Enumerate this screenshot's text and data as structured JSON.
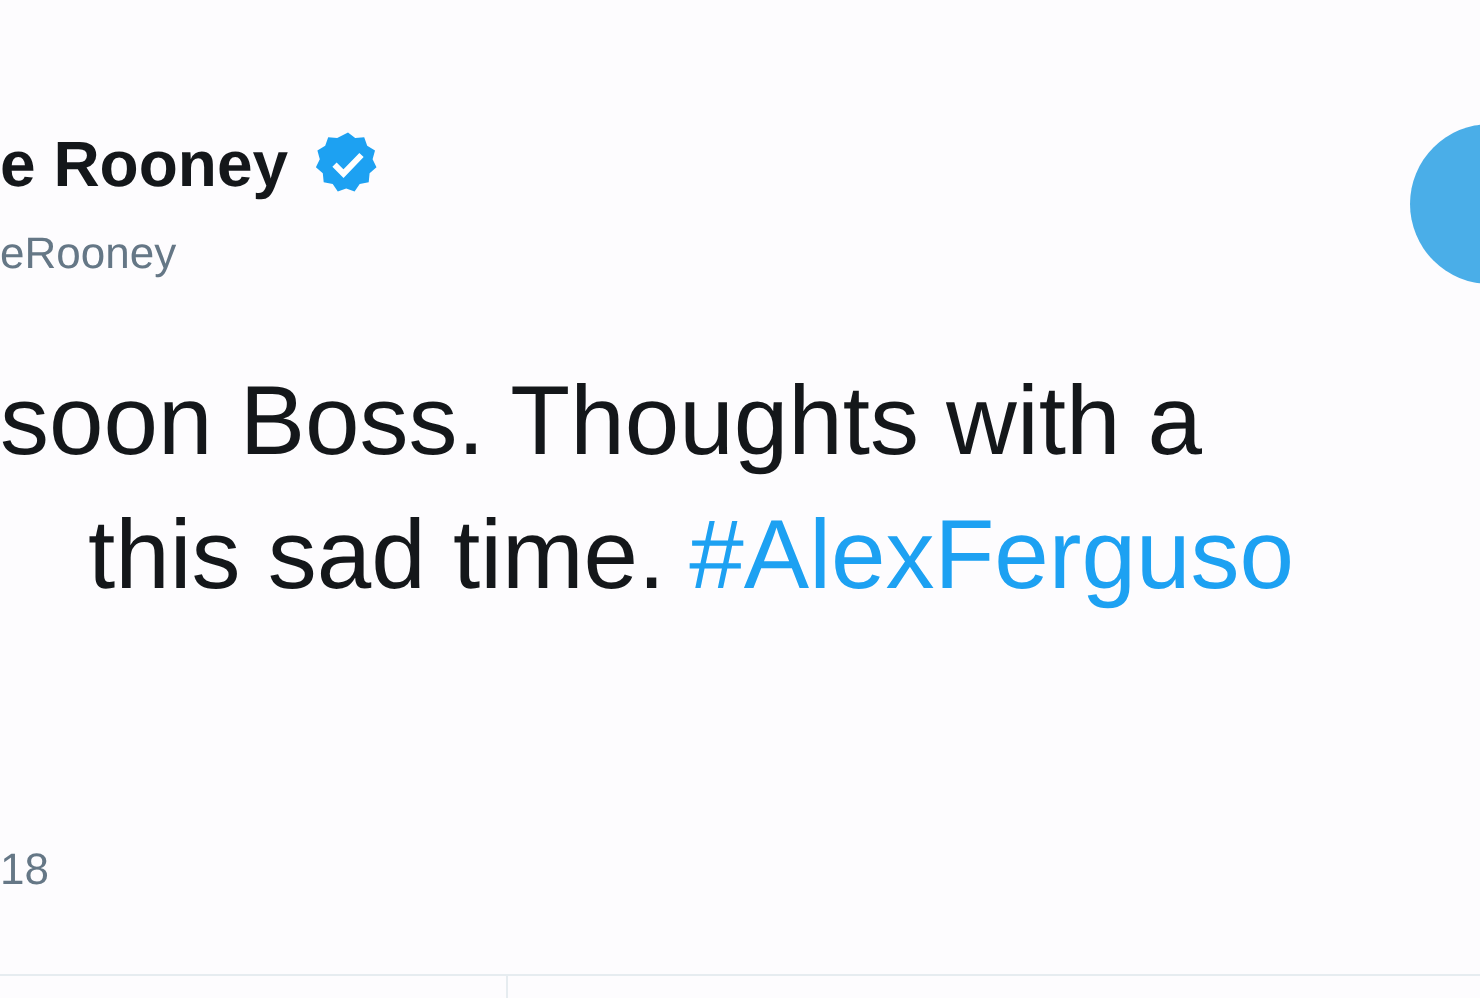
{
  "author": {
    "name": "e Rooney",
    "verified": true,
    "handle": "eRooney"
  },
  "tweet": {
    "lines": [
      {
        "text": "soon Boss. Thoughts with a"
      },
      {
        "text": "this sad time.",
        "hashtag": "#AlexFerguso"
      }
    ]
  },
  "timestamp": "18"
}
